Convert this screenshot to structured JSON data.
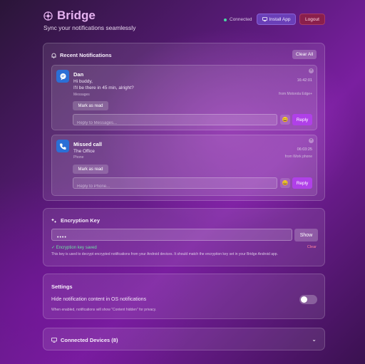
{
  "app": {
    "name": "Bridge",
    "tagline": "Sync your notifications seamlessly",
    "status": "Connected",
    "install_label": "Install App",
    "logout_label": "Logout"
  },
  "notifications": {
    "title": "Recent Notifications",
    "clear_all_label": "Clear All",
    "items": [
      {
        "sender": "Dan",
        "lines": [
          "Hi buddy,",
          "I'll be there in 45 min, alright?"
        ],
        "app": "Messages",
        "time": "16:42:01",
        "from": "from Motorola Edge+",
        "mark_read_label": "Mark as read",
        "reply_placeholder": "Reply to Messages...",
        "reply_label": "Reply"
      },
      {
        "sender": "Missed call",
        "lines": [
          "The Office"
        ],
        "app": "Phone",
        "time": "06:03:25",
        "from": "from Work phone",
        "mark_read_label": "Mark as read",
        "reply_placeholder": "Reply to Phone...",
        "reply_label": "Reply"
      }
    ]
  },
  "encryption": {
    "title": "Encryption Key",
    "key_value": "••••",
    "show_label": "Show",
    "saved_text": "✓ Encryption key saved",
    "clear_label": "Clear",
    "help_text": "This key is used to decrypt encrypted notifications from your Android devices. It should match the encryption key set in your Bridge Android app."
  },
  "settings": {
    "title": "Settings",
    "hide_content_label": "Hide notification content in OS notifications",
    "hide_content_help": "When enabled, notifications will show \"Content hidden\" for privacy.",
    "hide_content_enabled": false
  },
  "devices": {
    "title": "Connected Devices (8)"
  },
  "colors": {
    "accent": "#b040e8",
    "status": "#4ad9a4",
    "danger": "#ff7f9e"
  }
}
